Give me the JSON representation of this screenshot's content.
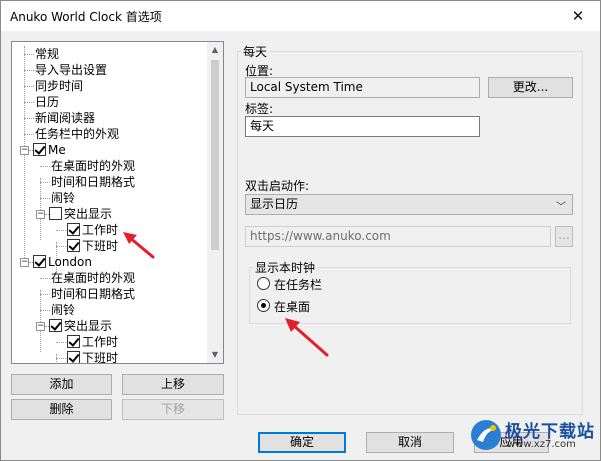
{
  "window": {
    "title": "Anuko World Clock 首选项"
  },
  "tree": {
    "items": [
      {
        "label": "常规",
        "type": "leaf"
      },
      {
        "label": "导入导出设置",
        "type": "leaf"
      },
      {
        "label": "同步时间",
        "type": "leaf"
      },
      {
        "label": "日历",
        "type": "leaf"
      },
      {
        "label": "新闻阅读器",
        "type": "leaf"
      },
      {
        "label": "任务栏中的外观",
        "type": "leaf"
      },
      {
        "label": "Me",
        "type": "parent",
        "checked": true
      },
      {
        "label": "在桌面时的外观",
        "type": "child"
      },
      {
        "label": "时间和日期格式",
        "type": "child"
      },
      {
        "label": "闹铃",
        "type": "child"
      },
      {
        "label": "突出显示",
        "type": "child-parent",
        "checked": false
      },
      {
        "label": "工作时",
        "type": "grandchild",
        "checked": true
      },
      {
        "label": "下班时",
        "type": "grandchild",
        "checked": true
      },
      {
        "label": "London",
        "type": "parent",
        "checked": true
      },
      {
        "label": "在桌面时的外观",
        "type": "child"
      },
      {
        "label": "时间和日期格式",
        "type": "child"
      },
      {
        "label": "闹铃",
        "type": "child"
      },
      {
        "label": "突出显示",
        "type": "child-parent",
        "checked": true
      },
      {
        "label": "工作时",
        "type": "grandchild",
        "checked": true
      },
      {
        "label": "下班时",
        "type": "grandchild",
        "checked": true
      }
    ]
  },
  "left_buttons": {
    "add": "添加",
    "move_up": "上移",
    "delete": "删除",
    "move_down": "下移"
  },
  "panel": {
    "group_title": "每天",
    "location_label": "位置:",
    "location_value": "Local System Time",
    "change_button": "更改...",
    "tag_label": "标签:",
    "tag_value": "每天",
    "dblclick_label": "双击启动作:",
    "dblclick_value": "显示日历",
    "url_value": "https://www.anuko.com",
    "url_button": "...",
    "show_clock_group": "显示本时钟",
    "radio_taskbar": "在任务栏",
    "radio_desktop": "在桌面",
    "selected_radio": "在桌面"
  },
  "footer": {
    "ok": "确定",
    "cancel": "取消",
    "apply": "应用"
  },
  "watermark": {
    "title": "极光下载站",
    "url": "www.xz7.com"
  },
  "colors": {
    "annotation_arrow": "#e0212b",
    "default_button_border": "#0078d7"
  }
}
